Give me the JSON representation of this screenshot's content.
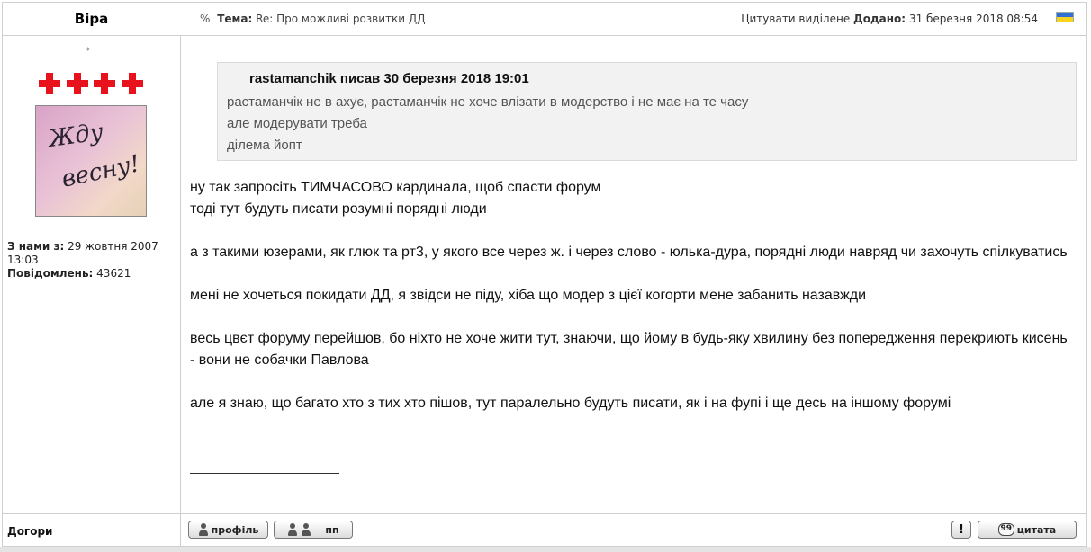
{
  "author": {
    "name": "Віра",
    "rank_symbol": "*",
    "joined_label": "З нами з:",
    "joined_value": "29 жовтня 2007 13:03",
    "posts_label": "Повідомлень:",
    "posts_value": "43621",
    "avatar_text_line1": "Жду",
    "avatar_text_line2": "весну!"
  },
  "header": {
    "topic_label": "Тема:",
    "topic_value": "Re: Про можливі розвитки ДД",
    "quote_selected": "Цитувати виділене",
    "added_label": "Додано:",
    "added_value": "31 березня 2018 08:54"
  },
  "quote": {
    "header": "rastamanchik писав 30 березня 2018 19:01",
    "lines": [
      "растаманчік не в ахує, растаманчік не хоче влізати в модерство і не має на те часу",
      "але модерувати треба",
      "ділема йопт"
    ]
  },
  "message": {
    "paragraphs": [
      "ну так запросіть ТИМЧАСОВО кардинала, щоб спасти форум\nтоді тут будуть писати розумні порядні люди",
      "а з такими юзерами, як глюк та рт3, у якого все через ж. і через слово - юлька-дура, порядні люди навряд чи захочуть спілкуватись",
      "мені не хочеться покидати ДД, я звідси не піду, хіба що модер з цієї когорти мене забанить назавжди",
      "весь цвєт форуму перейшов, бо ніхто не хоче жити тут, знаючи, що йому в будь-яку хвилину без попередження перекриють кисень - вони не собачки Павлова",
      "але я знаю, що багато хто з тих хто пішов, тут паралельно будуть писати, як і на фупі і ще десь на іншому форумі"
    ]
  },
  "footer": {
    "status": "Догори",
    "profile_button": "профіль",
    "pm_button": "пп",
    "report_button": "!",
    "quote_button": "цитата"
  },
  "icons": {
    "topic": "link-icon",
    "flag": "ukraine-flag-icon",
    "profile": "person-icon",
    "pm": "persons-icon",
    "quote": "speech-bubble-icon"
  },
  "colors": {
    "cross": "#e8121d",
    "flag_blue": "#2f6fd6",
    "flag_yellow": "#f6d31f",
    "quote_bg": "#f2f2f2"
  }
}
